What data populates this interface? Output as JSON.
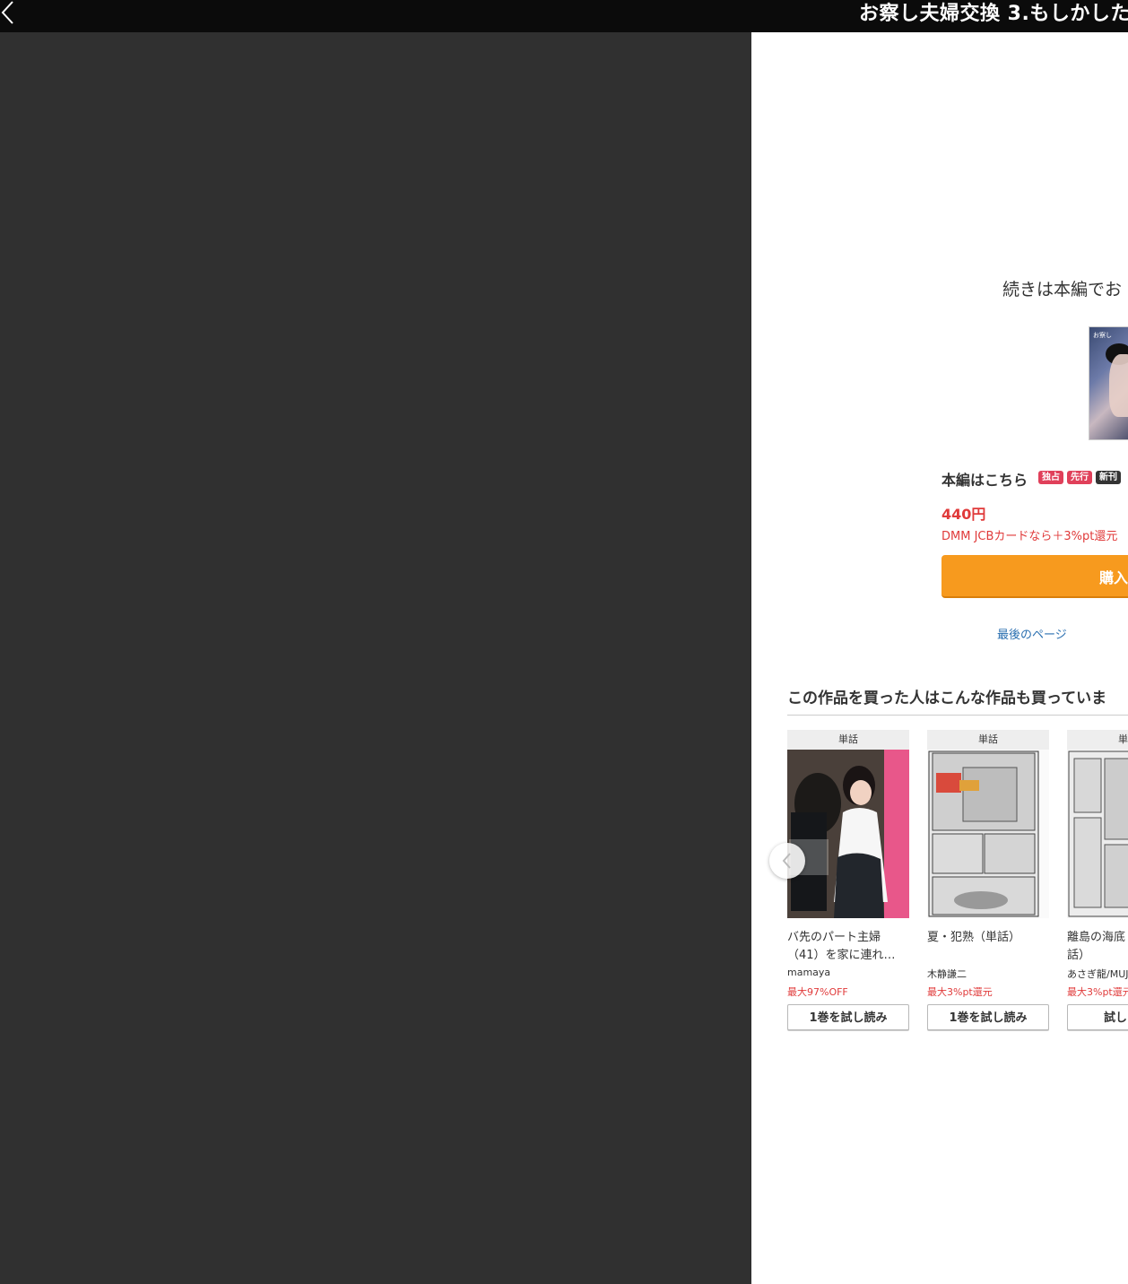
{
  "header": {
    "title": "お察し夫婦交換 3.もしかした"
  },
  "end_panel": {
    "continue_text": "続きは本編でお",
    "cover_text": "お察し",
    "main_label": "本編はこちら",
    "badges": [
      {
        "label": "独占",
        "color": "#e0405a"
      },
      {
        "label": "先行",
        "color": "#e0405a"
      },
      {
        "label": "新刊",
        "color": "#333333"
      }
    ],
    "price": "440円",
    "point_note": "DMM JCBカードなら＋3%pt還元",
    "buy_label": "購入",
    "last_page_link": "最後のページ"
  },
  "recommendations": {
    "title": "この作品を買った人はこんな作品も買っていま",
    "items": [
      {
        "type": "単話",
        "name_line1": "バ先のパート主婦",
        "name_line2": "（41）を家に連れ…",
        "author": "mamaya",
        "offer": "最大97%OFF",
        "trial_label": "1巻を試し読み"
      },
      {
        "type": "単話",
        "name_line1": "夏・犯熟（単話）",
        "name_line2": "",
        "author": "木静謙二",
        "offer": "最大3%pt還元",
        "trial_label": "1巻を試し読み"
      },
      {
        "type": "単話",
        "name_line1": "離島の海底",
        "name_line2": "話）",
        "author": "あさぎ龍/MUJ",
        "offer": "最大3%pt還元",
        "trial_label": "試し"
      }
    ]
  },
  "colors": {
    "accent_orange": "#f79a1e",
    "price_red": "#e03a3a",
    "link_blue": "#2a6fb0",
    "viewer_bg": "#303030",
    "topbar_bg": "#0b0b0b"
  },
  "icons": {
    "back": "chevron-left-icon",
    "carousel_prev": "chevron-left-icon"
  }
}
